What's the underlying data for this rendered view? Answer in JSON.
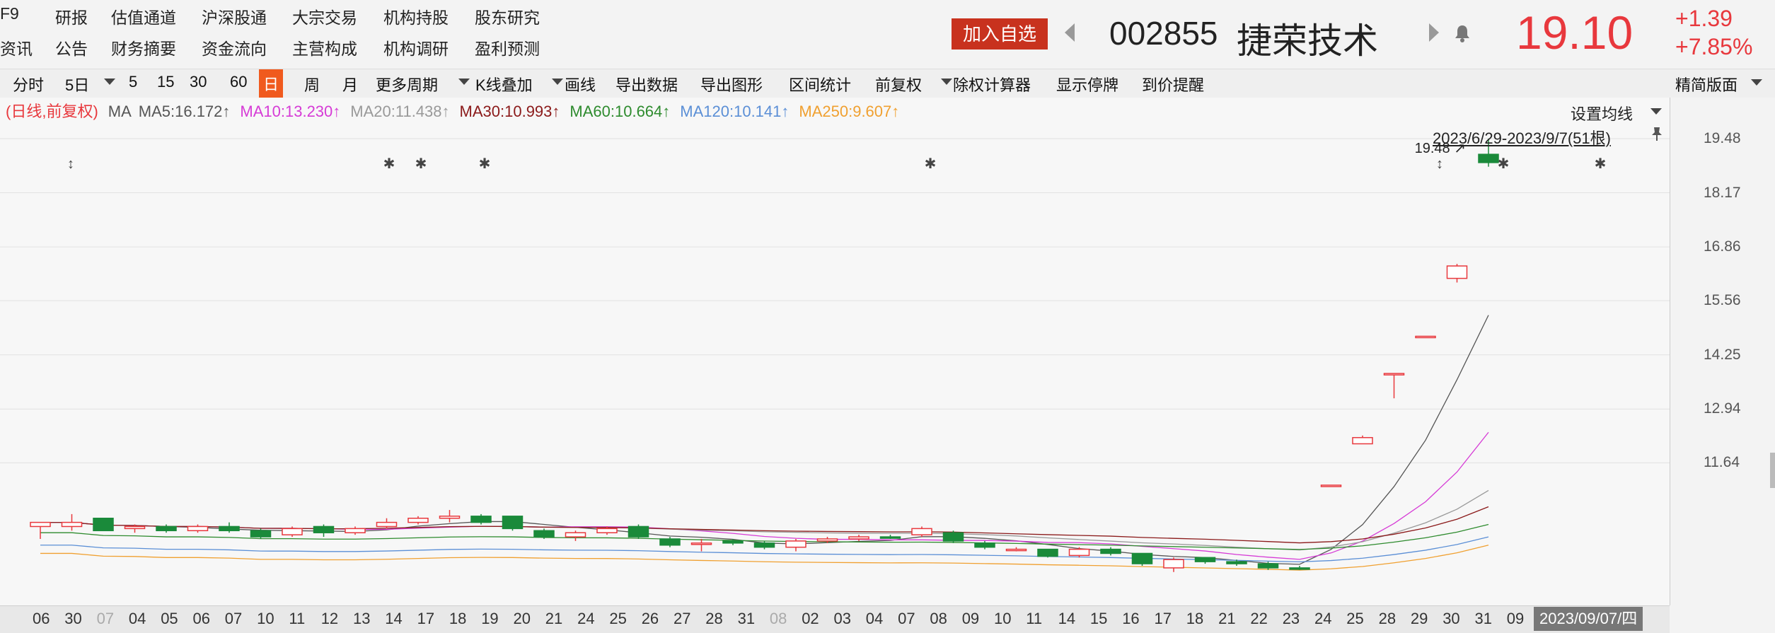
{
  "top_nav": {
    "row1": [
      "F9",
      "研报",
      "估值通道",
      "沪深股通",
      "大宗交易",
      "机构持股",
      "股东研究"
    ],
    "row2": [
      "资讯",
      "公告",
      "财务摘要",
      "资金流向",
      "主营构成",
      "机构调研",
      "盈利预测"
    ]
  },
  "stock": {
    "add_watch": "加入自选",
    "code": "002855",
    "name": "捷荣技术",
    "price": "19.10",
    "change": "+1.39",
    "change_pct": "+7.85%"
  },
  "toolbar": {
    "items": [
      "分时",
      "5日",
      "5",
      "15",
      "30",
      "60",
      "日",
      "周",
      "月",
      "更多周期",
      "K线叠加",
      "画线",
      "导出数据",
      "导出图形",
      "区间统计",
      "前复权",
      "除权计算器",
      "显示停牌",
      "到价提醒"
    ],
    "active": "日",
    "right": "精简版面"
  },
  "ma_legend": {
    "label": "(日线,前复权)",
    "ma": "MA",
    "items": [
      {
        "text": "MA5:16.172",
        "color": "#555555"
      },
      {
        "text": "MA10:13.230",
        "color": "#d63bd6"
      },
      {
        "text": "MA20:11.438",
        "color": "#999999"
      },
      {
        "text": "MA30:10.993",
        "color": "#8b1a1a"
      },
      {
        "text": "MA60:10.664",
        "color": "#2e8b2e"
      },
      {
        "text": "MA120:10.141",
        "color": "#5b8fd6"
      },
      {
        "text": "MA250:9.607",
        "color": "#f0a030"
      }
    ],
    "arrow": "↑"
  },
  "settings": {
    "ma_setting": "设置均线",
    "range": "2023/6/29-2023/9/7(51根)"
  },
  "price_axis": [
    "19.48",
    "18.17",
    "16.86",
    "15.56",
    "14.25",
    "12.94",
    "11.64"
  ],
  "high_label": "19.48",
  "dates": [
    "06",
    "30",
    "07",
    "04",
    "05",
    "06",
    "07",
    "10",
    "11",
    "12",
    "13",
    "14",
    "17",
    "18",
    "19",
    "20",
    "21",
    "24",
    "25",
    "26",
    "27",
    "28",
    "31",
    "08",
    "02",
    "03",
    "04",
    "07",
    "08",
    "09",
    "10",
    "11",
    "14",
    "15",
    "16",
    "17",
    "18",
    "21",
    "22",
    "23",
    "24",
    "25",
    "28",
    "29",
    "30",
    "31",
    "09",
    "2023/09/07/四"
  ],
  "colors": {
    "up": "#e8383d",
    "down": "#1a8a3a",
    "accent": "#e8383d"
  },
  "chart_data": {
    "type": "candlestick",
    "ylim": [
      8.5,
      20.3
    ],
    "candles": [
      {
        "o": 10.1,
        "h": 10.2,
        "l": 9.8,
        "c": 10.2
      },
      {
        "o": 10.1,
        "h": 10.4,
        "l": 10.0,
        "c": 10.2
      },
      {
        "o": 10.3,
        "h": 10.3,
        "l": 10.0,
        "c": 10.0
      },
      {
        "o": 10.05,
        "h": 10.15,
        "l": 9.95,
        "c": 10.1
      },
      {
        "o": 10.1,
        "h": 10.15,
        "l": 9.95,
        "c": 10.0
      },
      {
        "o": 10.0,
        "h": 10.15,
        "l": 9.95,
        "c": 10.1
      },
      {
        "o": 10.1,
        "h": 10.2,
        "l": 9.95,
        "c": 10.0
      },
      {
        "o": 10.0,
        "h": 10.05,
        "l": 9.8,
        "c": 9.85
      },
      {
        "o": 9.9,
        "h": 10.1,
        "l": 9.85,
        "c": 10.05
      },
      {
        "o": 10.1,
        "h": 10.15,
        "l": 9.85,
        "c": 9.95
      },
      {
        "o": 9.95,
        "h": 10.1,
        "l": 9.9,
        "c": 10.05
      },
      {
        "o": 10.1,
        "h": 10.3,
        "l": 10.05,
        "c": 10.2
      },
      {
        "o": 10.2,
        "h": 10.35,
        "l": 10.15,
        "c": 10.3
      },
      {
        "o": 10.3,
        "h": 10.5,
        "l": 10.2,
        "c": 10.35
      },
      {
        "o": 10.35,
        "h": 10.4,
        "l": 10.15,
        "c": 10.2
      },
      {
        "o": 10.35,
        "h": 10.35,
        "l": 10.0,
        "c": 10.05
      },
      {
        "o": 10.0,
        "h": 10.05,
        "l": 9.8,
        "c": 9.85
      },
      {
        "o": 9.85,
        "h": 10.0,
        "l": 9.75,
        "c": 9.95
      },
      {
        "o": 9.95,
        "h": 10.1,
        "l": 9.9,
        "c": 10.05
      },
      {
        "o": 10.1,
        "h": 10.15,
        "l": 9.8,
        "c": 9.85
      },
      {
        "o": 9.8,
        "h": 9.85,
        "l": 9.6,
        "c": 9.65
      },
      {
        "o": 9.7,
        "h": 9.8,
        "l": 9.5,
        "c": 9.7
      },
      {
        "o": 9.75,
        "h": 9.8,
        "l": 9.65,
        "c": 9.7
      },
      {
        "o": 9.7,
        "h": 9.75,
        "l": 9.55,
        "c": 9.6
      },
      {
        "o": 9.6,
        "h": 9.8,
        "l": 9.5,
        "c": 9.75
      },
      {
        "o": 9.75,
        "h": 9.85,
        "l": 9.7,
        "c": 9.8
      },
      {
        "o": 9.8,
        "h": 9.9,
        "l": 9.75,
        "c": 9.85
      },
      {
        "o": 9.85,
        "h": 9.9,
        "l": 9.8,
        "c": 9.82
      },
      {
        "o": 9.9,
        "h": 10.1,
        "l": 9.85,
        "c": 10.05
      },
      {
        "o": 9.95,
        "h": 10.0,
        "l": 9.7,
        "c": 9.75
      },
      {
        "o": 9.7,
        "h": 9.75,
        "l": 9.55,
        "c": 9.6
      },
      {
        "o": 9.55,
        "h": 9.6,
        "l": 9.5,
        "c": 9.55
      },
      {
        "o": 9.55,
        "h": 9.55,
        "l": 9.35,
        "c": 9.38
      },
      {
        "o": 9.4,
        "h": 9.6,
        "l": 9.35,
        "c": 9.55
      },
      {
        "o": 9.55,
        "h": 9.6,
        "l": 9.4,
        "c": 9.45
      },
      {
        "o": 9.45,
        "h": 9.45,
        "l": 9.15,
        "c": 9.2
      },
      {
        "o": 9.1,
        "h": 9.35,
        "l": 9.0,
        "c": 9.3
      },
      {
        "o": 9.35,
        "h": 9.35,
        "l": 9.2,
        "c": 9.25
      },
      {
        "o": 9.25,
        "h": 9.3,
        "l": 9.15,
        "c": 9.2
      },
      {
        "o": 9.2,
        "h": 9.25,
        "l": 9.05,
        "c": 9.1
      },
      {
        "o": 9.1,
        "h": 9.15,
        "l": 9.05,
        "c": 9.08
      },
      {
        "o": 11.1,
        "h": 11.1,
        "l": 11.1,
        "c": 11.1
      },
      {
        "o": 12.1,
        "h": 12.3,
        "l": 12.1,
        "c": 12.25
      },
      {
        "o": 13.8,
        "h": 13.8,
        "l": 13.2,
        "c": 13.8
      },
      {
        "o": 14.7,
        "h": 14.7,
        "l": 14.7,
        "c": 14.7
      },
      {
        "o": 16.1,
        "h": 16.45,
        "l": 16.0,
        "c": 16.4
      },
      {
        "o": 19.1,
        "h": 19.48,
        "l": 18.8,
        "c": 18.9
      }
    ]
  }
}
